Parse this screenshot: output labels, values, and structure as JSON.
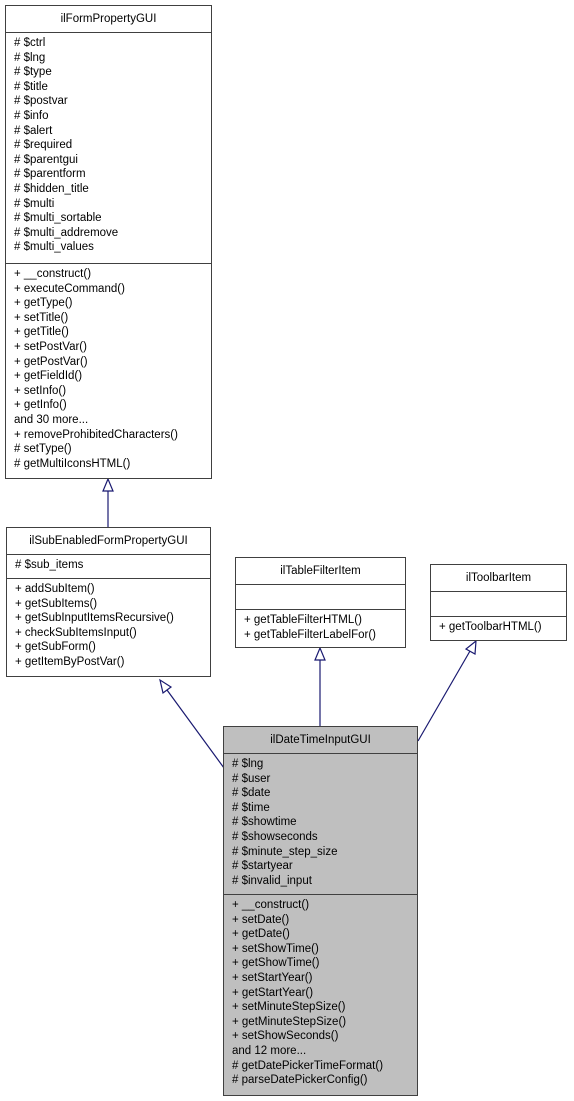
{
  "diagram": {
    "edge_color": "#191970",
    "classes": {
      "base": {
        "name": "ilFormPropertyGUI",
        "attributes": [
          "# $ctrl",
          "# $lng",
          "# $type",
          "# $title",
          "# $postvar",
          "# $info",
          "# $alert",
          "# $required",
          "# $parentgui",
          "# $parentform",
          "# $hidden_title",
          "# $multi",
          "# $multi_sortable",
          "# $multi_addremove",
          "# $multi_values"
        ],
        "methods": [
          "+ __construct()",
          "+ executeCommand()",
          "+ getType()",
          "+ setTitle()",
          "+ getTitle()",
          "+ setPostVar()",
          "+ getPostVar()",
          "+ getFieldId()",
          "+ setInfo()",
          "+ getInfo()",
          "and 30 more...",
          "+ removeProhibitedCharacters()",
          "# setType()",
          "# getMultiIconsHTML()"
        ]
      },
      "subenabled": {
        "name": "ilSubEnabledFormPropertyGUI",
        "attributes": [
          "# $sub_items"
        ],
        "methods": [
          "+ addSubItem()",
          "+ getSubItems()",
          "+ getSubInputItemsRecursive()",
          "+ checkSubItemsInput()",
          "+ getSubForm()",
          "+ getItemByPostVar()"
        ]
      },
      "tablefilter": {
        "name": "ilTableFilterItem",
        "attributes": [],
        "methods": [
          "+ getTableFilterHTML()",
          "+ getTableFilterLabelFor()"
        ]
      },
      "toolbar": {
        "name": "ilToolbarItem",
        "attributes": [],
        "methods": [
          "+ getToolbarHTML()"
        ]
      },
      "datetime": {
        "name": "ilDateTimeInputGUI",
        "attributes": [
          "# $lng",
          "# $user",
          "# $date",
          "# $time",
          "# $showtime",
          "# $showseconds",
          "# $minute_step_size",
          "# $startyear",
          "# $invalid_input"
        ],
        "methods": [
          "+ __construct()",
          "+ setDate()",
          "+ getDate()",
          "+ setShowTime()",
          "+ getShowTime()",
          "+ setStartYear()",
          "+ getStartYear()",
          "+ setMinuteStepSize()",
          "+ getMinuteStepSize()",
          "+ setShowSeconds()",
          "and 12 more...",
          "# getDatePickerTimeFormat()",
          "# parseDatePickerConfig()"
        ]
      }
    },
    "edges": [
      {
        "from": "subenabled",
        "to": "base",
        "type": "inheritance"
      },
      {
        "from": "datetime",
        "to": "subenabled",
        "type": "inheritance"
      },
      {
        "from": "datetime",
        "to": "tablefilter",
        "type": "inheritance"
      },
      {
        "from": "datetime",
        "to": "toolbar",
        "type": "inheritance"
      }
    ]
  }
}
